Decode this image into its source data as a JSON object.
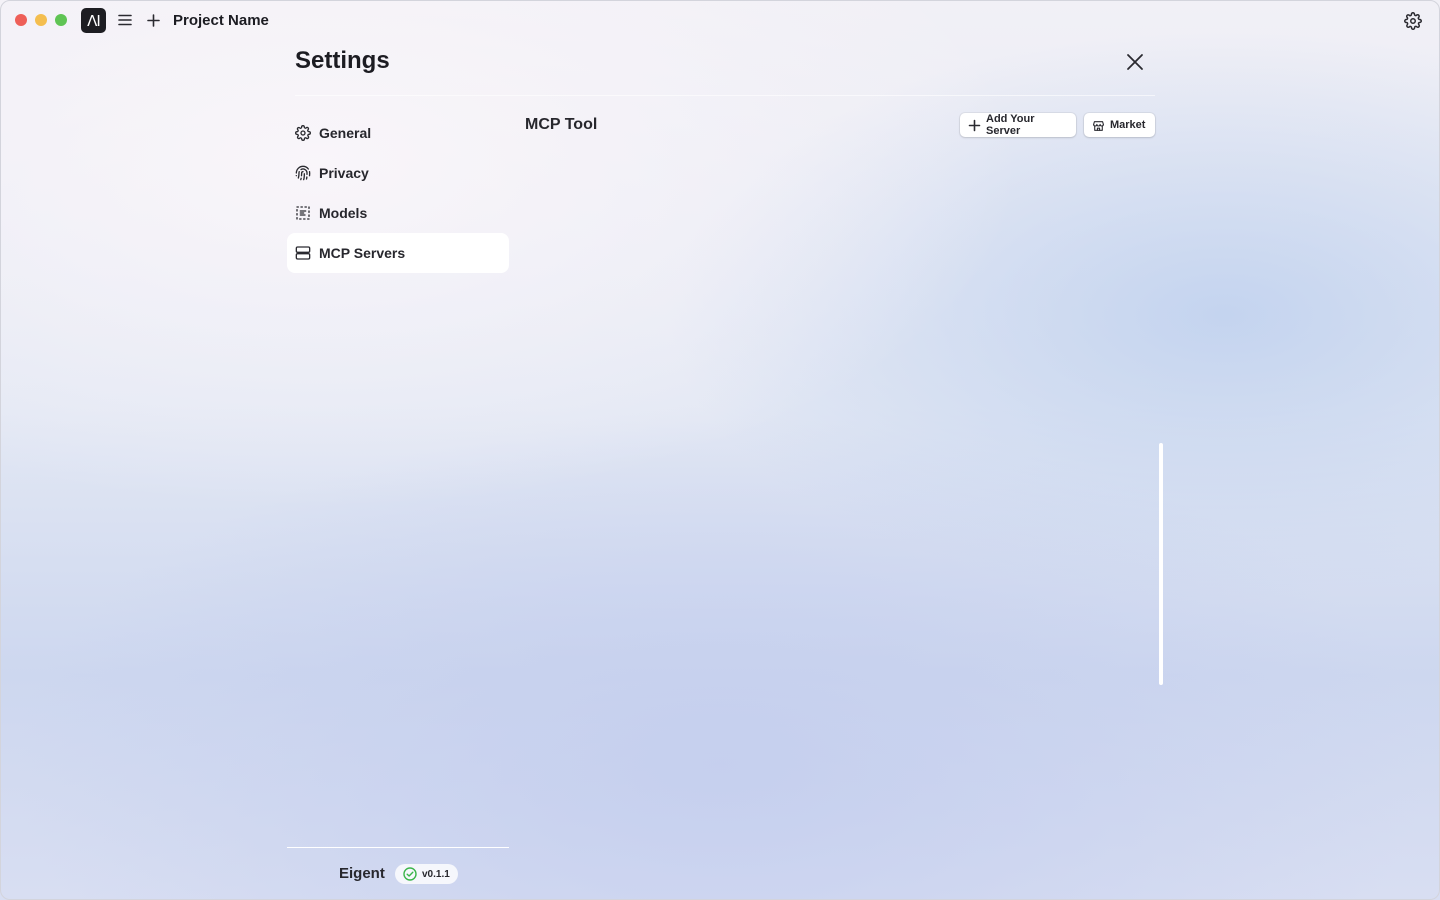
{
  "titlebar": {
    "logo_text": "ΛI",
    "project_name": "Project Name",
    "icons": [
      "menu-icon",
      "plus-icon",
      "gear-icon"
    ]
  },
  "settings": {
    "title": "Settings",
    "nav": [
      {
        "label": "General",
        "icon": "gear-icon",
        "active": false
      },
      {
        "label": "Privacy",
        "icon": "fingerprint-icon",
        "active": false
      },
      {
        "label": "Models",
        "icon": "model-icon",
        "active": false
      },
      {
        "label": "MCP Servers",
        "icon": "server-icon",
        "active": true
      }
    ]
  },
  "content": {
    "title": "MCP Tool",
    "add_server_label": "Add Your Server",
    "market_label": "Market"
  },
  "footer": {
    "brand": "Eigent",
    "version": "v0.1.1",
    "version_status_color": "#3bb54a"
  },
  "colors": {
    "active_nav_bg": "#ffffff",
    "traffic_red": "#ee5f58",
    "traffic_yellow": "#f4be4f",
    "traffic_green": "#5fc454"
  }
}
